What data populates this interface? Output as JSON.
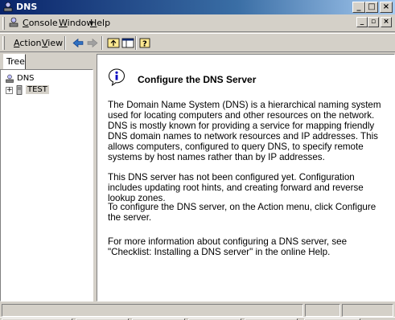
{
  "window": {
    "title": "DNS"
  },
  "menubar": {
    "console_label": "Console",
    "window_label": "Window",
    "help_label": "Help"
  },
  "toolbar": {
    "action_label": "Action",
    "view_label": "View"
  },
  "tree": {
    "tab_label": "Tree",
    "root_label": "DNS",
    "server_label": "TEST"
  },
  "content": {
    "heading": "Configure the DNS Server",
    "para1": "The Domain Name System (DNS) is a hierarchical naming system used for locating computers and other resources on the network. DNS is mostly known for providing a service for mapping friendly DNS domain names to network resources and IP addresses. This allows computers, configured to query DNS, to specify remote systems by host names rather than by IP addresses.",
    "para2": "This DNS server has not been configured yet. Configuration includes updating root hints, and creating forward and reverse lookup zones.",
    "para3": "To configure the DNS server, on the Action menu, click Configure the server.",
    "para4": "For more information about configuring a DNS server, see \"Checklist: Installing a DNS server\" in the online Help."
  },
  "colors": {
    "titlebar_start": "#0a246a",
    "titlebar_end": "#a6caf0",
    "face": "#d4d0c8"
  }
}
